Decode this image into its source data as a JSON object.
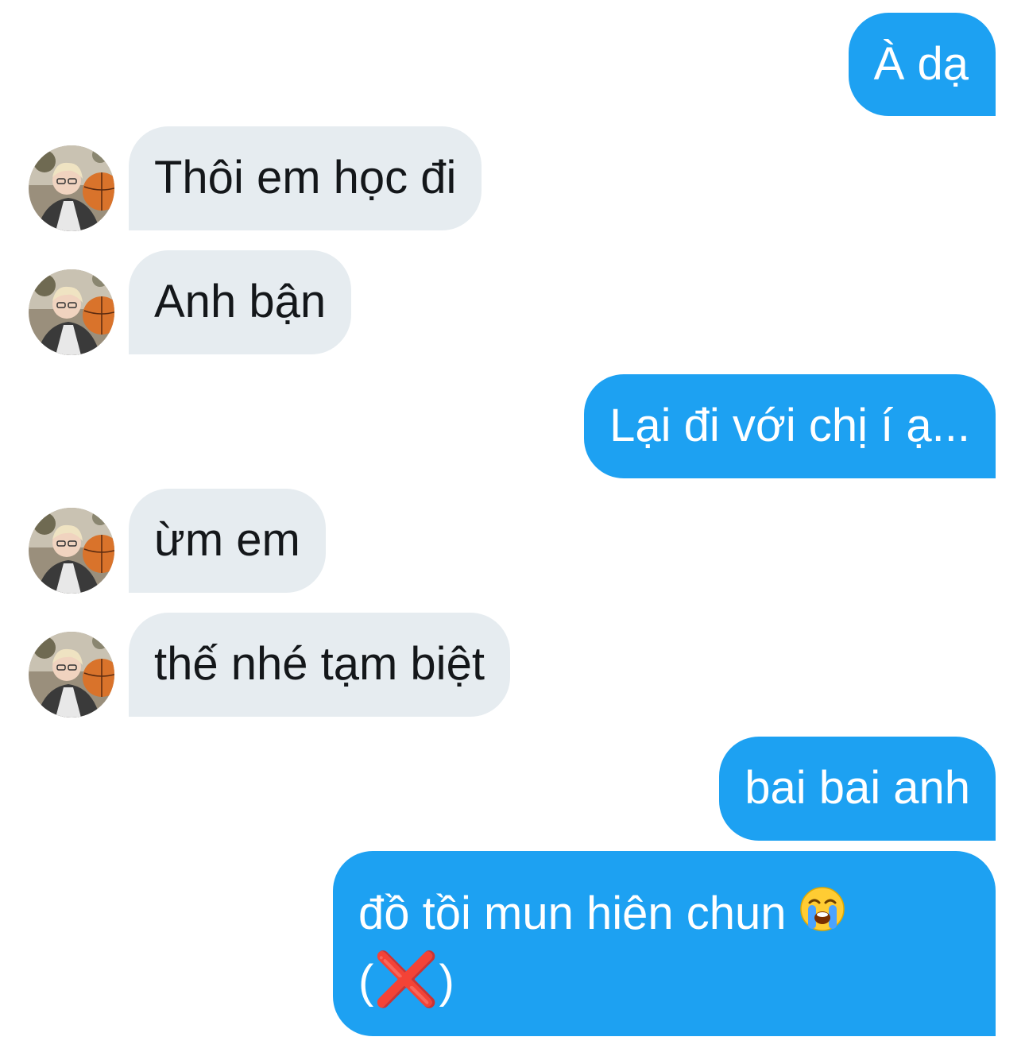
{
  "messages": [
    {
      "sender": "me",
      "text": "À dạ"
    },
    {
      "sender": "other",
      "text": "Thôi em học đi"
    },
    {
      "sender": "other",
      "text": "Anh bận"
    },
    {
      "sender": "me",
      "text": "Lại đi với chị í ạ..."
    },
    {
      "sender": "other",
      "text": "ừm em"
    },
    {
      "sender": "other",
      "text": "thế nhé tạm biệt"
    },
    {
      "sender": "me",
      "text": "bai bai anh"
    },
    {
      "sender": "me",
      "text_line1": "đồ tồi mun hiên chun",
      "emoji": "loudly-crying-face",
      "text_line2_open": "(",
      "text_line2_mark": "❌",
      "text_line2_close": ")"
    }
  ],
  "colors": {
    "outgoing_bubble": "#1da1f2",
    "incoming_bubble": "#e6ecf0",
    "outgoing_text": "#ffffff",
    "incoming_text": "#14171a"
  },
  "avatar_icon": "user-photo-with-basketball"
}
